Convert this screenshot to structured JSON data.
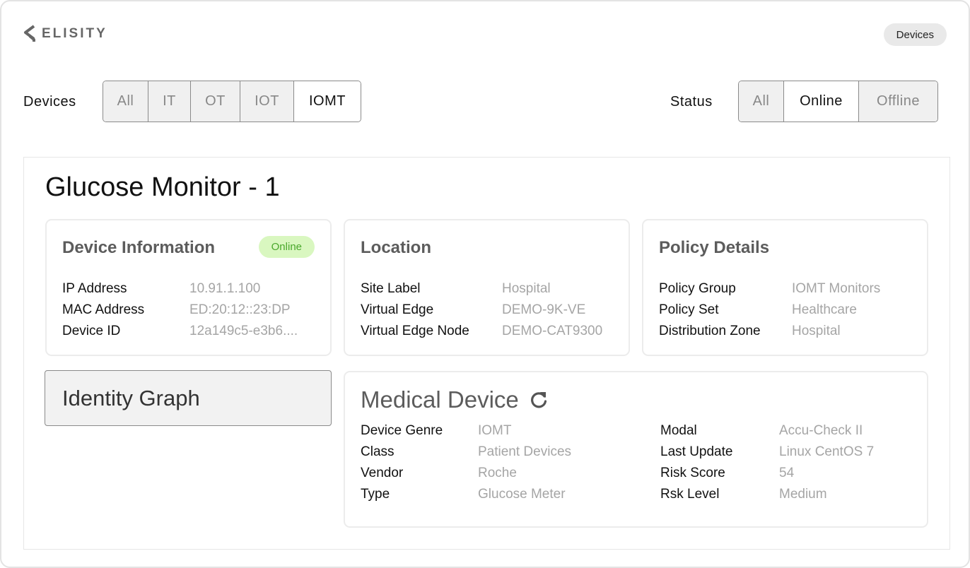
{
  "header": {
    "logo_text": "ELISITY",
    "devices_button": "Devices"
  },
  "filters": {
    "devices_label": "Devices",
    "device_types": [
      "All",
      "IT",
      "OT",
      "IOT",
      "IOMT"
    ],
    "device_type_selected": "IOMT",
    "status_label": "Status",
    "statuses": [
      "All",
      "Online",
      "Offline"
    ],
    "status_selected": "Online"
  },
  "device": {
    "title": "Glucose Monitor - 1"
  },
  "device_info": {
    "title": "Device Information",
    "status_badge": "Online",
    "rows": [
      {
        "label": "IP Address",
        "value": "10.91.1.100"
      },
      {
        "label": "MAC Address",
        "value": "ED:20:12::23:DP"
      },
      {
        "label": "Device ID",
        "value": "12a149c5-e3b6...."
      }
    ]
  },
  "location": {
    "title": "Location",
    "rows": [
      {
        "label": "Site Label",
        "value": "Hospital"
      },
      {
        "label": "Virtual Edge",
        "value": "DEMO-9K-VE"
      },
      {
        "label": "Virtual Edge Node",
        "value": "DEMO-CAT9300"
      }
    ]
  },
  "policy": {
    "title": "Policy Details",
    "rows": [
      {
        "label": "Policy Group",
        "value": "IOMT Monitors"
      },
      {
        "label": "Policy Set",
        "value": "Healthcare"
      },
      {
        "label": "Distribution Zone",
        "value": "Hospital"
      }
    ]
  },
  "identity_graph": {
    "label": "Identity Graph"
  },
  "medical_device": {
    "title": "Medical Device",
    "left_rows": [
      {
        "label": "Device Genre",
        "value": "IOMT"
      },
      {
        "label": "Class",
        "value": "Patient Devices"
      },
      {
        "label": "Vendor",
        "value": "Roche"
      },
      {
        "label": "Type",
        "value": "Glucose Meter"
      }
    ],
    "right_rows": [
      {
        "label": "Modal",
        "value": "Accu-Check II"
      },
      {
        "label": "Last Update",
        "value": "Linux CentOS 7"
      },
      {
        "label": "Risk Score",
        "value": "54"
      },
      {
        "label": "Rsk Level",
        "value": "Medium"
      }
    ]
  }
}
